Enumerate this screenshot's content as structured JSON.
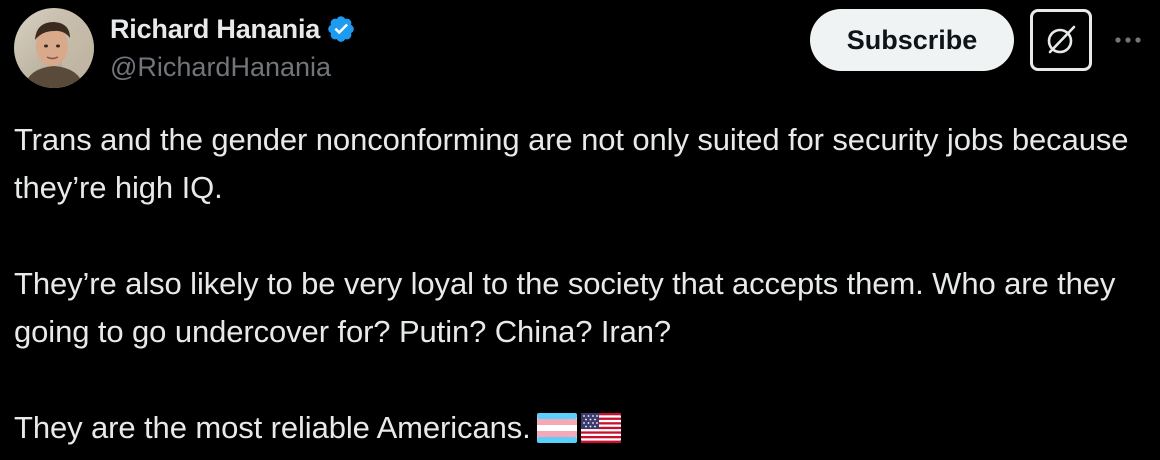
{
  "author": {
    "display_name": "Richard Hanania",
    "handle": "@RichardHanania",
    "verified_badge_color": "#1d9bf0"
  },
  "actions": {
    "subscribe_label": "Subscribe",
    "grok_icon": "grok-icon",
    "more_icon": "more-icon"
  },
  "tweet": {
    "paragraphs": [
      "Trans and the gender nonconforming are not only suited for security jobs because they’re high IQ.",
      "They’re also likely to be very loyal to the society that accepts them. Who are they going to go undercover for? Putin? China? Iran?",
      "They are the most reliable Americans."
    ],
    "emojis": [
      "transgender-flag",
      "us-flag"
    ]
  },
  "colors": {
    "background": "#000000",
    "text_primary": "#e7e9ea",
    "text_secondary": "#71767b",
    "button_bg": "#eff3f4",
    "button_text": "#0f1419"
  }
}
